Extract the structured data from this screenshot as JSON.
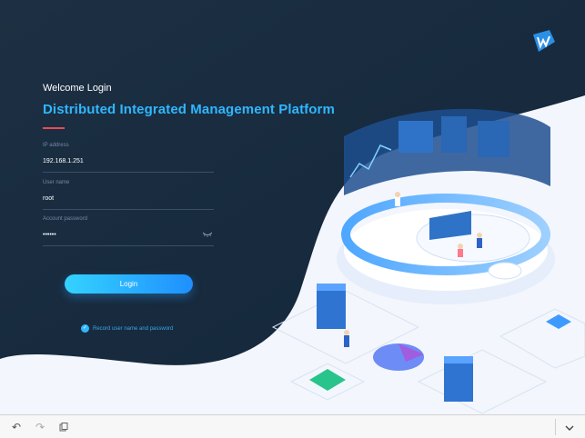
{
  "login": {
    "welcome": "Welcome Login",
    "title": "Distributed Integrated Management Platform",
    "ip_label": "IP address",
    "ip_value": "192.168.1.251",
    "user_label": "User name",
    "user_value": "root",
    "password_label": "Account password",
    "password_value": "••••••",
    "login_button": "Login",
    "remember_label": "Record user name and password",
    "remember_checked": true
  },
  "colors": {
    "panel_background": "#172a3d",
    "accent": "#2fb7ff",
    "title_underline": "#ea4b57"
  },
  "icons": {
    "logo": "brand-logo-icon",
    "show_password": "eye-icon",
    "remember": "check-circle-icon"
  },
  "toolbar": {
    "undo": "undo-icon",
    "redo": "redo-icon",
    "clipboard": "clipboard-icon",
    "collapse": "chevron-down-icon"
  }
}
